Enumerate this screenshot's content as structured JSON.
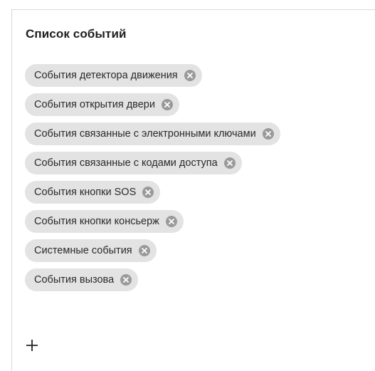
{
  "panel": {
    "title": "Список событий"
  },
  "event_chips": [
    {
      "label": "События детектора движения",
      "remove_icon": "close-circle-icon"
    },
    {
      "label": "События открытия двери",
      "remove_icon": "close-circle-icon"
    },
    {
      "label": "События связанные с электронными ключами",
      "remove_icon": "close-circle-icon"
    },
    {
      "label": "События связанные с кодами доступа",
      "remove_icon": "close-circle-icon"
    },
    {
      "label": "События кнопки SOS",
      "remove_icon": "close-circle-icon"
    },
    {
      "label": "События кнопки консьерж",
      "remove_icon": "close-circle-icon"
    },
    {
      "label": "Системные события",
      "remove_icon": "close-circle-icon"
    },
    {
      "label": "События вызова",
      "remove_icon": "close-circle-icon"
    }
  ],
  "add_button": {
    "icon": "plus-icon"
  },
  "colors": {
    "chip_background": "#e3e3e3",
    "remove_icon_fill": "#9a9a9a",
    "title_text": "#1f1f1f",
    "panel_border": "#d9d9d9"
  }
}
